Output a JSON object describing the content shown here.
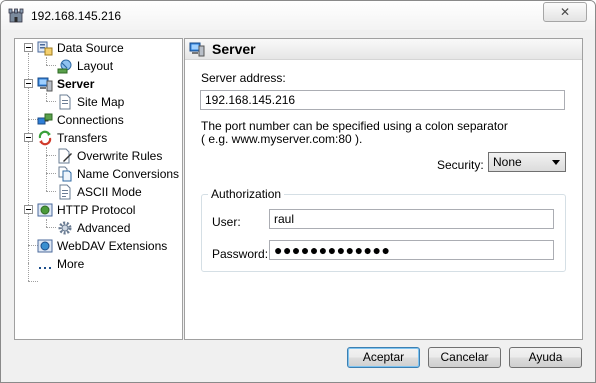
{
  "window": {
    "title": "192.168.145.216",
    "close_glyph": "✕",
    "app_icon": "castle-icon"
  },
  "tree": {
    "items": [
      {
        "label": "Data Source",
        "icon": "data-source-icon",
        "bold": false
      },
      {
        "label": "Layout",
        "icon": "layout-icon",
        "bold": false
      },
      {
        "label": "Server",
        "icon": "server-icon",
        "bold": true
      },
      {
        "label": "Site Map",
        "icon": "site-map-icon",
        "bold": false
      },
      {
        "label": "Connections",
        "icon": "connections-icon",
        "bold": false
      },
      {
        "label": "Transfers",
        "icon": "transfers-icon",
        "bold": false
      },
      {
        "label": "Overwrite Rules",
        "icon": "overwrite-rules-icon",
        "bold": false
      },
      {
        "label": "Name Conversions",
        "icon": "name-conversions-icon",
        "bold": false
      },
      {
        "label": "ASCII Mode",
        "icon": "ascii-mode-icon",
        "bold": false
      },
      {
        "label": "HTTP Protocol",
        "icon": "http-protocol-icon",
        "bold": false
      },
      {
        "label": "Advanced",
        "icon": "advanced-gear-icon",
        "bold": false
      },
      {
        "label": "WebDAV Extensions",
        "icon": "webdav-icon",
        "bold": false
      },
      {
        "label": "More",
        "icon": "ellipsis-icon",
        "bold": false
      }
    ]
  },
  "panel": {
    "title": "Server",
    "server_address_label": "Server address:",
    "server_address_value": "192.168.145.216",
    "port_note_line1": "The port number can be specified using a colon separator",
    "port_note_line2": "( e.g. www.myserver.com:80 ).",
    "security_label": "Security:",
    "security_value": "None",
    "authorization_legend": "Authorization",
    "user_label": "User:",
    "user_value": "raul",
    "password_label": "Password:",
    "password_value": "●●●●●●●●●●●●●"
  },
  "buttons": {
    "accept": "Aceptar",
    "cancel": "Cancelar",
    "help": "Ayuda"
  },
  "colors": {
    "accent_blue": "#3c7fb1",
    "window_bg": "#f0f0f0"
  }
}
